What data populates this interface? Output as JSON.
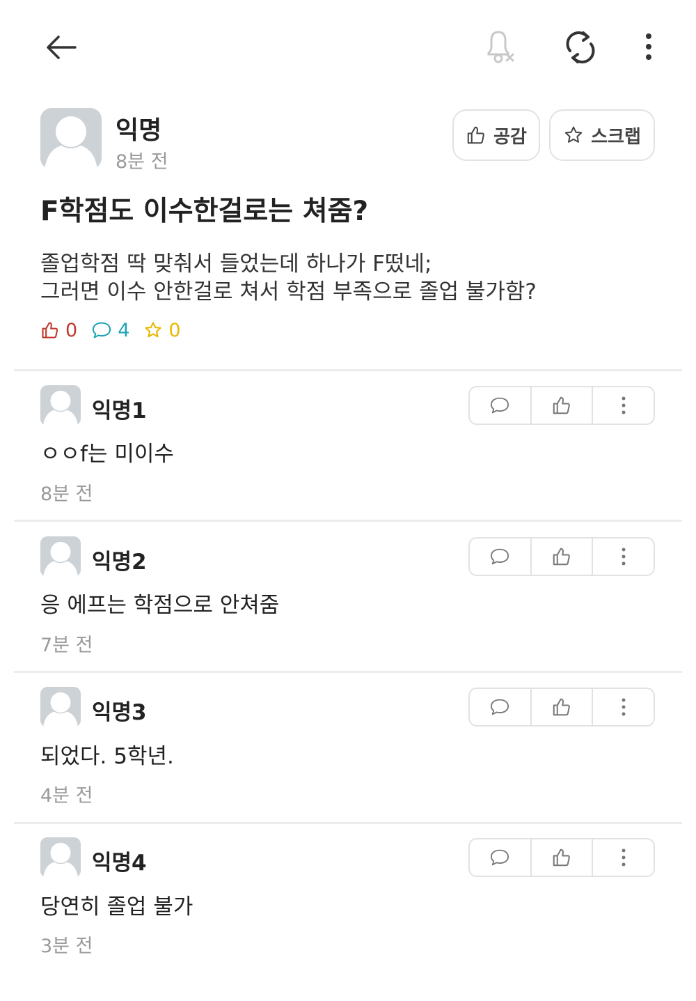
{
  "toolbar": {
    "icons": [
      "arrow-left-icon",
      "bell-off-icon",
      "refresh-icon",
      "more-vertical-icon"
    ]
  },
  "post": {
    "author": "익명",
    "time": "8분 전",
    "like_label": "공감",
    "scrap_label": "스크랩",
    "title": "F학점도 이수한걸로는 쳐줌?",
    "body": [
      "졸업학점 딱 맞춰서 들었는데 하나가 F떴네;",
      "그러면 이수 안한걸로 쳐서 학점 부족으로 졸업 불가함?"
    ],
    "stats": {
      "likes": "0",
      "comments": "4",
      "scraps": "0"
    },
    "colors": {
      "like": "#c0392b",
      "comment": "#1fa3b8",
      "scrap": "#e6b800"
    }
  },
  "comments": [
    {
      "author": "익명1",
      "text": "ㅇㅇf는 미이수",
      "time": "8분 전"
    },
    {
      "author": "익명2",
      "text": "응 에프는 학점으로 안쳐줌",
      "time": "7분 전"
    },
    {
      "author": "익명3",
      "text": "되었다. 5학년.",
      "time": "4분 전"
    },
    {
      "author": "익명4",
      "text": "당연히 졸업 불가",
      "time": "3분 전"
    }
  ]
}
